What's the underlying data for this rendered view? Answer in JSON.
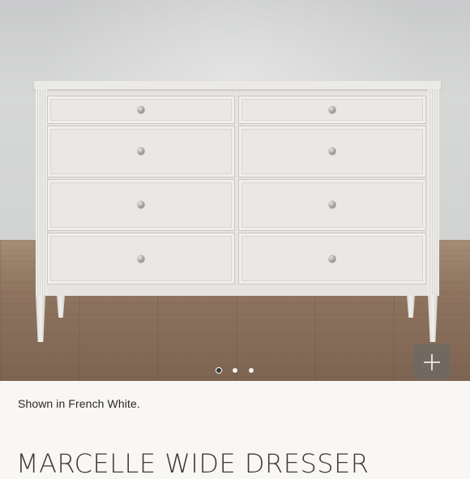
{
  "product": {
    "image_alt": "Marcelle Wide Dresser in French White",
    "caption": "Shown in French White.",
    "title": "MARCELLE WIDE DRESSER"
  },
  "gallery": {
    "total_slides": 3,
    "active_index": 0,
    "zoom_icon": "plus-icon"
  },
  "colors": {
    "finish": "#e6e4e0",
    "zoom_button": "#6e6862",
    "active_dot": "#3a3937"
  }
}
